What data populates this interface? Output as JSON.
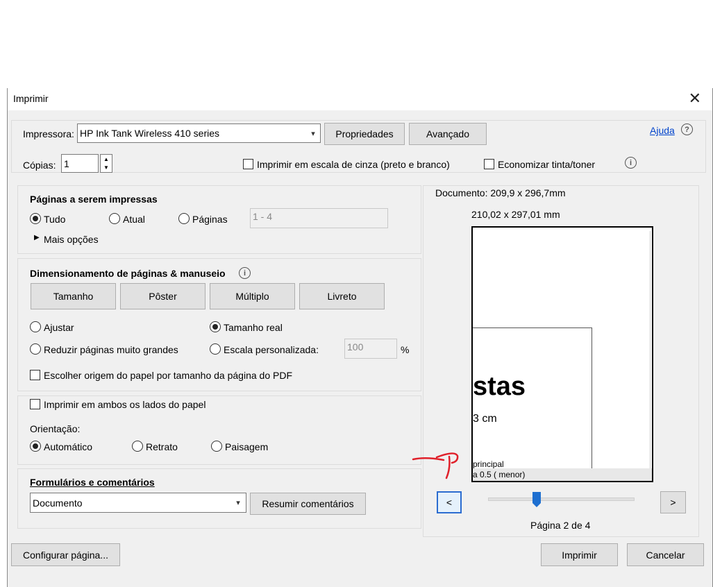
{
  "window": {
    "title": "Imprimir",
    "close_label": "✕"
  },
  "printer": {
    "label": "Impressora:",
    "value": "HP Ink Tank Wireless 410 series",
    "properties_label": "Propriedades",
    "advanced_label": "Avançado",
    "help_label": "Ajuda",
    "help_icon": "?",
    "copies_label": "Cópias:",
    "copies_value": "1",
    "grayscale_label": "Imprimir em escala de cinza (preto e branco)",
    "save_ink_label": "Economizar tinta/toner",
    "info_icon": "i"
  },
  "pages": {
    "heading": "Páginas a serem impressas",
    "all_label": "Tudo",
    "current_label": "Atual",
    "pages_label": "Páginas",
    "pages_value": "1 - 4",
    "more_options_label": "Mais opções"
  },
  "sizing": {
    "heading": "Dimensionamento de páginas & manuseio",
    "info_icon": "i",
    "tabs": [
      "Tamanho",
      "Pôster",
      "Múltiplo",
      "Livreto"
    ],
    "fit_label": "Ajustar",
    "actual_size_label": "Tamanho real",
    "shrink_label": "Reduzir páginas muito grandes",
    "custom_scale_label": "Escala personalizada:",
    "custom_scale_value": "100",
    "percent_label": "%",
    "paper_source_label": "Escolher origem do papel por tamanho da página do PDF"
  },
  "duplex": {
    "both_sides_label": "Imprimir em ambos os lados do papel",
    "orientation_label": "Orientação:",
    "auto_label": "Automático",
    "portrait_label": "Retrato",
    "landscape_label": "Paisagem"
  },
  "forms": {
    "heading": "Formulários e comentários",
    "value": "Documento",
    "summarize_label": "Resumir comentários"
  },
  "preview": {
    "document_size": "Documento: 209,9 x 296,7mm",
    "page_size": "210,02 x 297,01 mm",
    "page_text_big": "stas",
    "page_text_cm": "3 cm",
    "page_text_principal": "principal",
    "page_text_small": "a 0.5 ( menor)",
    "prev_label": "<",
    "next_label": ">",
    "page_indicator": "Página 2 de 4",
    "slider_fraction": 0.33
  },
  "footer": {
    "page_setup_label": "Configurar página...",
    "print_label": "Imprimir",
    "cancel_label": "Cancelar"
  },
  "colors": {
    "slider_thumb": "#1e6fd0",
    "annotation": "#e0202a",
    "link": "#0044cc"
  }
}
